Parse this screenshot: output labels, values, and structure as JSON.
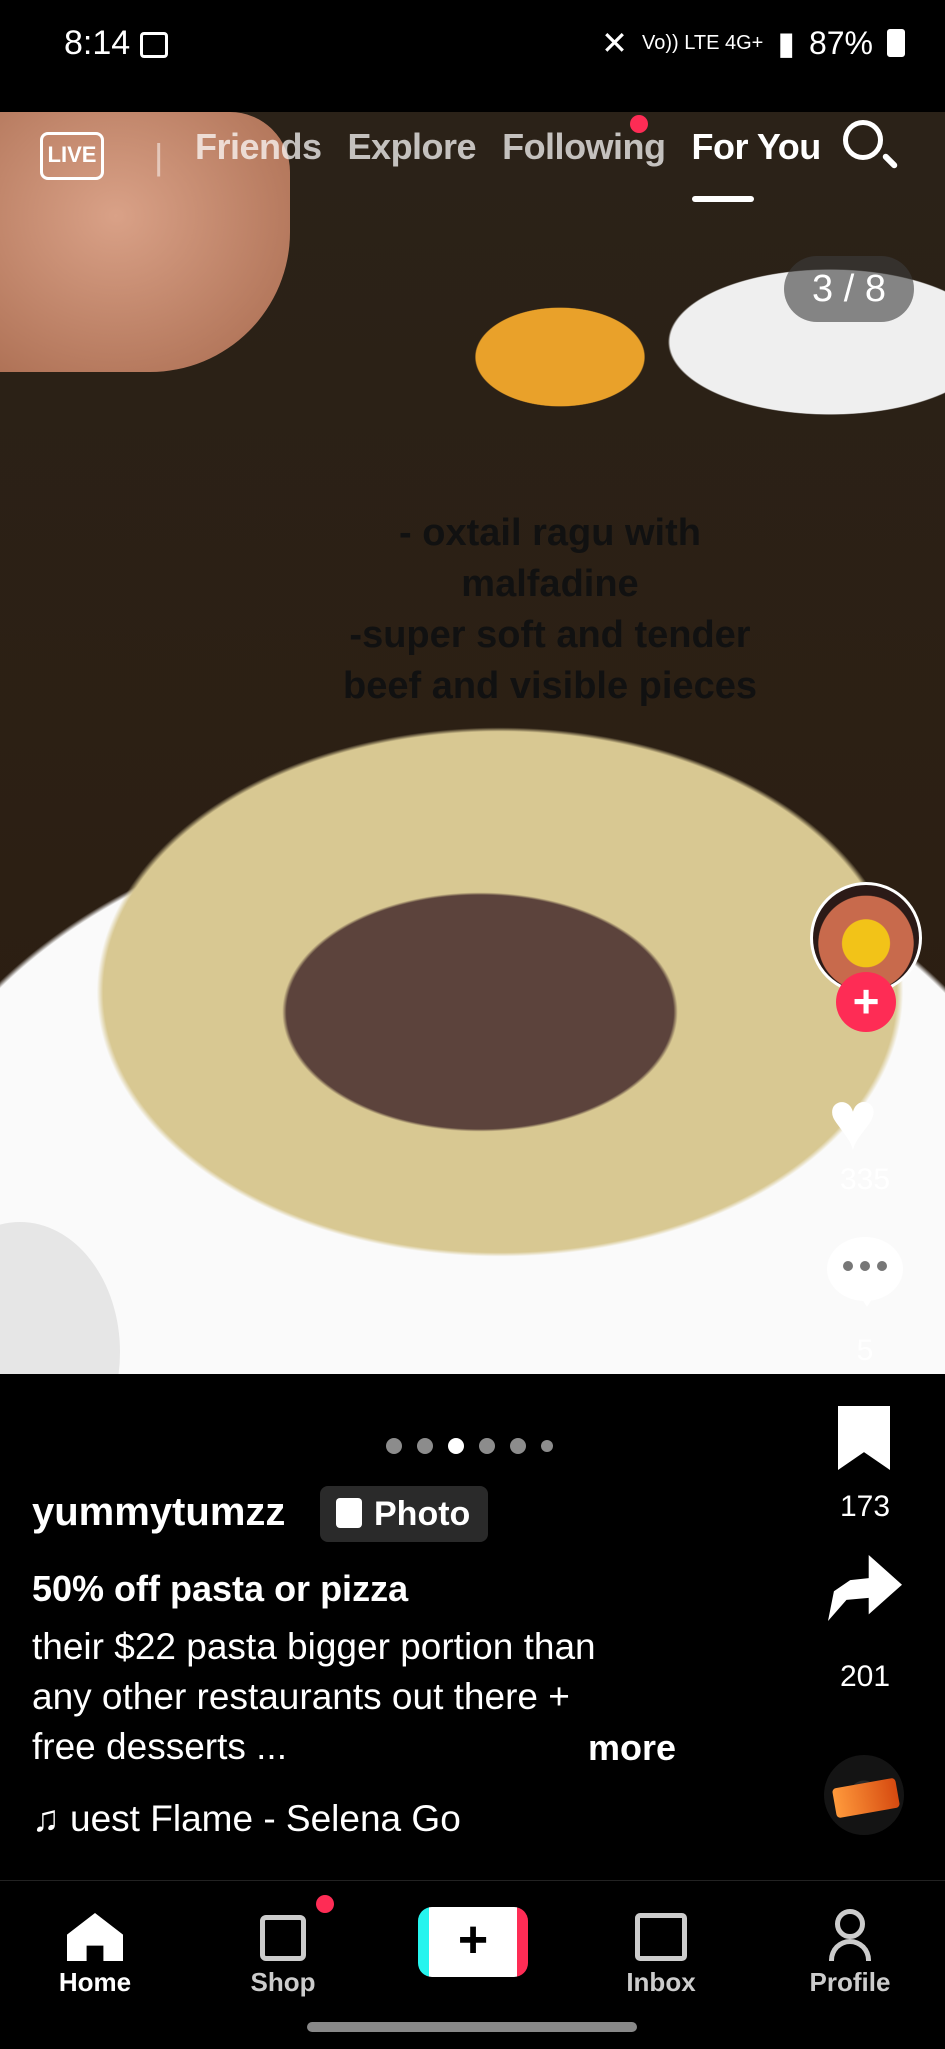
{
  "status_bar": {
    "time": "8:14",
    "signal": "Vo)) LTE 4G+",
    "battery": "87%"
  },
  "top_nav": {
    "live_label": "LIVE",
    "tabs": [
      {
        "label": "Friends"
      },
      {
        "label": "Explore"
      },
      {
        "label": "Following"
      },
      {
        "label": "For You"
      }
    ],
    "active_tab": "For You"
  },
  "slide_counter": "3 / 8",
  "caption_lines": [
    "- oxtail ragu with",
    "malfadine",
    "-super soft and tender",
    "beef and visible pieces"
  ],
  "actions": {
    "likes": "335",
    "comments": "5",
    "saves": "173",
    "shares": "201"
  },
  "post": {
    "username": "yummytumzz",
    "type_badge": "Photo",
    "title": "50% off pasta or pizza",
    "description_lines": [
      "their $22 pasta bigger portion than",
      "any other restaurants out there +",
      "free desserts ..."
    ],
    "more_label": "more",
    "music": "♫ uest Flame - Selena Go",
    "current_slide": 3
  },
  "bottom_nav": {
    "home": "Home",
    "shop": "Shop",
    "create": "+",
    "inbox": "Inbox",
    "profile": "Profile"
  },
  "colors": {
    "accent": "#fe2c55",
    "create_left": "#25f4ee"
  }
}
